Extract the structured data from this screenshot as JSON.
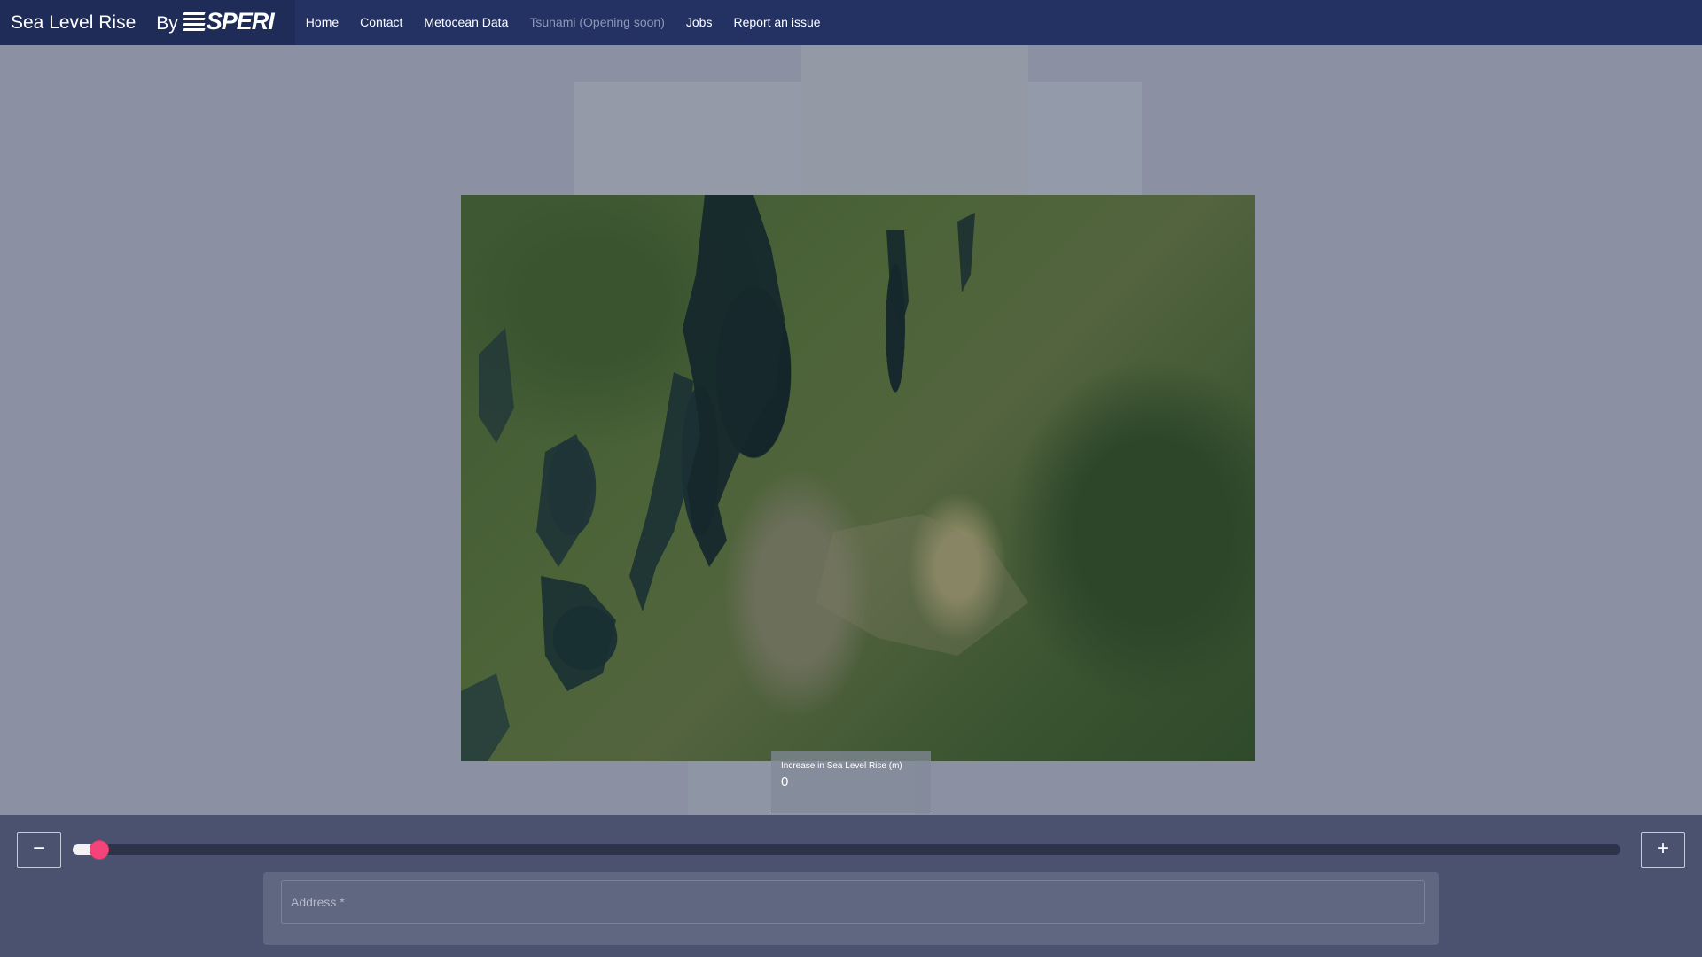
{
  "navbar": {
    "title": "Sea Level Rise",
    "by": "By",
    "logo_text": "SPERI",
    "links": [
      {
        "label": "Home"
      },
      {
        "label": "Contact"
      },
      {
        "label": "Metocean Data"
      },
      {
        "label": "Tsunami (Opening soon)",
        "disabled": true
      },
      {
        "label": "Jobs"
      },
      {
        "label": "Report an issue"
      }
    ]
  },
  "map": {
    "sea_level_label": "Increase in Sea Level Rise (m)",
    "sea_level_value": "0"
  },
  "controls": {
    "minus_label": "−",
    "plus_label": "+",
    "slider_value_fraction": 0.017,
    "address_placeholder": "Address *"
  },
  "colors": {
    "navbar": "#243263",
    "slider_thumb": "#f5447a",
    "bottom_panel": "#4a5270"
  }
}
